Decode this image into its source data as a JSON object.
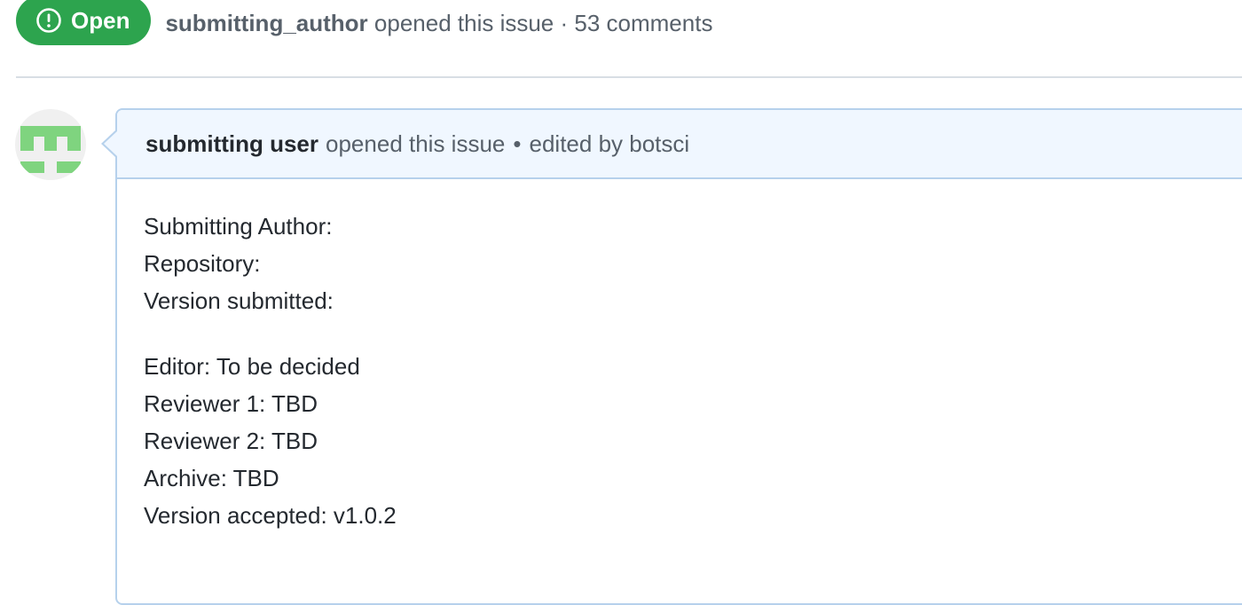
{
  "issue": {
    "state_label": "Open",
    "author": "submitting_author",
    "meta_text": "opened this issue · 53 comments"
  },
  "comment": {
    "author": "submitting user",
    "action": "opened this issue",
    "separator": "•",
    "edited": "edited by botsci",
    "block1": [
      "Submitting Author:",
      "Repository:",
      "Version submitted:"
    ],
    "block2": [
      "Editor: To be decided",
      "Reviewer 1: TBD",
      "Reviewer 2: TBD",
      "Archive: TBD",
      "Version accepted: v1.0.2"
    ]
  },
  "colors": {
    "open_green": "#2da44e",
    "header_blue_bg": "#f0f7ff",
    "border_blue": "#b6d1ec",
    "avatar_green": "#7fd47f"
  },
  "icons": {
    "state": "issue-opened-icon",
    "avatar": "identicon-avatar"
  }
}
